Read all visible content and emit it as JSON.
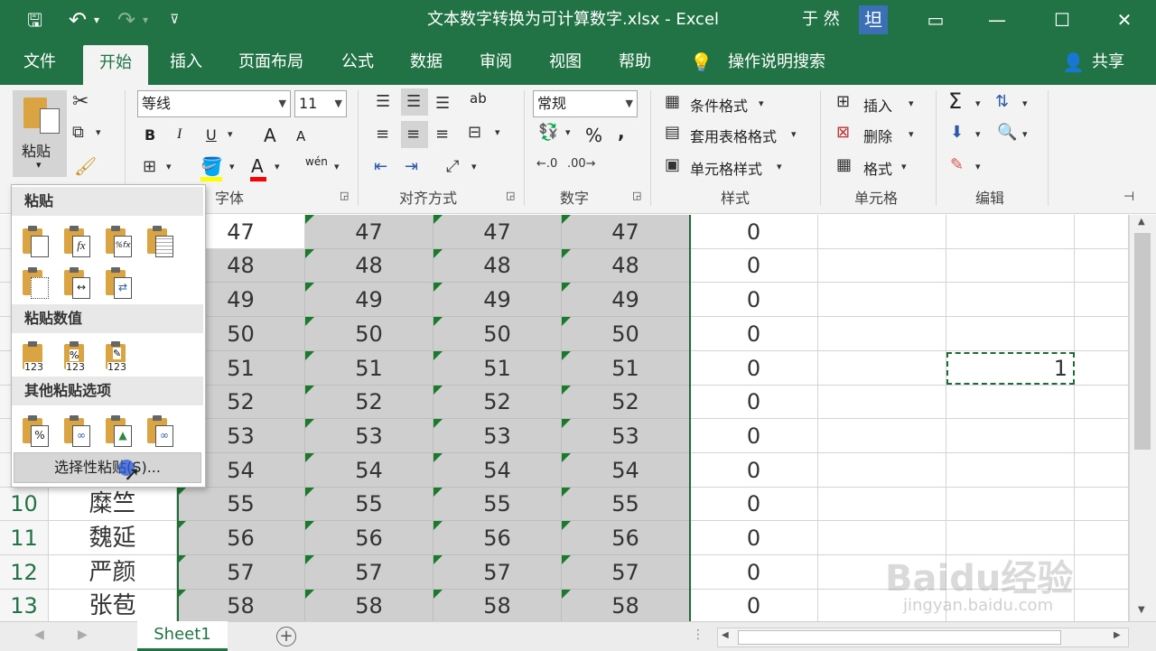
{
  "window": {
    "title": "文本数字转换为可计算数字.xlsx  -  Excel",
    "user": "于 然",
    "user_badge": "坦",
    "controls": {
      "restore": "▭",
      "minimize": "—",
      "maximize": "☐",
      "close": "✕"
    }
  },
  "qat": {
    "save": "🖫",
    "undo": "↶",
    "undo_arrow": "▾",
    "redo": "↷",
    "redo_arrow": "▾",
    "customize": "⊽"
  },
  "tabs": [
    "文件",
    "开始",
    "插入",
    "页面布局",
    "公式",
    "数据",
    "审阅",
    "视图",
    "帮助"
  ],
  "tell_me": "操作说明搜索",
  "share": "共享",
  "ribbon": {
    "clipboard": {
      "paste": "粘贴",
      "paste_arrow": "▾"
    },
    "font": {
      "name": "等线",
      "size": "11",
      "label": "字体",
      "bold": "B",
      "italic": "I",
      "underline": "U",
      "grow": "A",
      "shrink": "A",
      "color": "A",
      "phonetic": "wén"
    },
    "alignment": {
      "label": "对齐方式",
      "wrap": "ab"
    },
    "number": {
      "format": "常规",
      "label": "数字",
      "percent": "%",
      "comma": ","
    },
    "styles": {
      "conditional": "条件格式",
      "table": "套用表格格式",
      "cell": "单元格样式",
      "label": "样式"
    },
    "cells": {
      "insert": "插入",
      "delete": "删除",
      "format": "格式",
      "label": "单元格"
    },
    "editing": {
      "label": "编辑",
      "sum": "Σ"
    }
  },
  "paste_menu": {
    "section1": "粘贴",
    "section2": "粘贴数值",
    "section3": "其他粘贴选项",
    "special": "选择性粘贴(S)...",
    "icon_text_123": "123",
    "icon_text_fx": "fx",
    "icon_text_pfx": "%fx"
  },
  "sheet": {
    "rows": [
      {
        "num": "",
        "name": "",
        "vals": [
          "47",
          "47",
          "47",
          "47"
        ],
        "result": "0"
      },
      {
        "num": "",
        "name": "",
        "vals": [
          "48",
          "48",
          "48",
          "48"
        ],
        "result": "0"
      },
      {
        "num": "",
        "name": "",
        "vals": [
          "49",
          "49",
          "49",
          "49"
        ],
        "result": "0"
      },
      {
        "num": "",
        "name": "",
        "vals": [
          "50",
          "50",
          "50",
          "50"
        ],
        "result": "0"
      },
      {
        "num": "",
        "name": "",
        "vals": [
          "51",
          "51",
          "51",
          "51"
        ],
        "result": "0"
      },
      {
        "num": "",
        "name": "",
        "vals": [
          "52",
          "52",
          "52",
          "52"
        ],
        "result": "0"
      },
      {
        "num": "",
        "name": "",
        "vals": [
          "53",
          "53",
          "53",
          "53"
        ],
        "result": "0"
      },
      {
        "num": "",
        "name": "",
        "vals": [
          "54",
          "54",
          "54",
          "54"
        ],
        "result": "0"
      },
      {
        "num": "10",
        "name": "糜竺",
        "vals": [
          "55",
          "55",
          "55",
          "55"
        ],
        "result": "0"
      },
      {
        "num": "11",
        "name": "魏延",
        "vals": [
          "56",
          "56",
          "56",
          "56"
        ],
        "result": "0"
      },
      {
        "num": "12",
        "name": "严颜",
        "vals": [
          "57",
          "57",
          "57",
          "57"
        ],
        "result": "0"
      },
      {
        "num": "13",
        "name": "张苞",
        "vals": [
          "58",
          "58",
          "58",
          "58"
        ],
        "result": "0"
      }
    ],
    "copied_value": "1",
    "tab_name": "Sheet1",
    "add_sheet": "+"
  },
  "watermark": {
    "brand": "Baidu经验",
    "url": "jingyan.baidu.com"
  }
}
